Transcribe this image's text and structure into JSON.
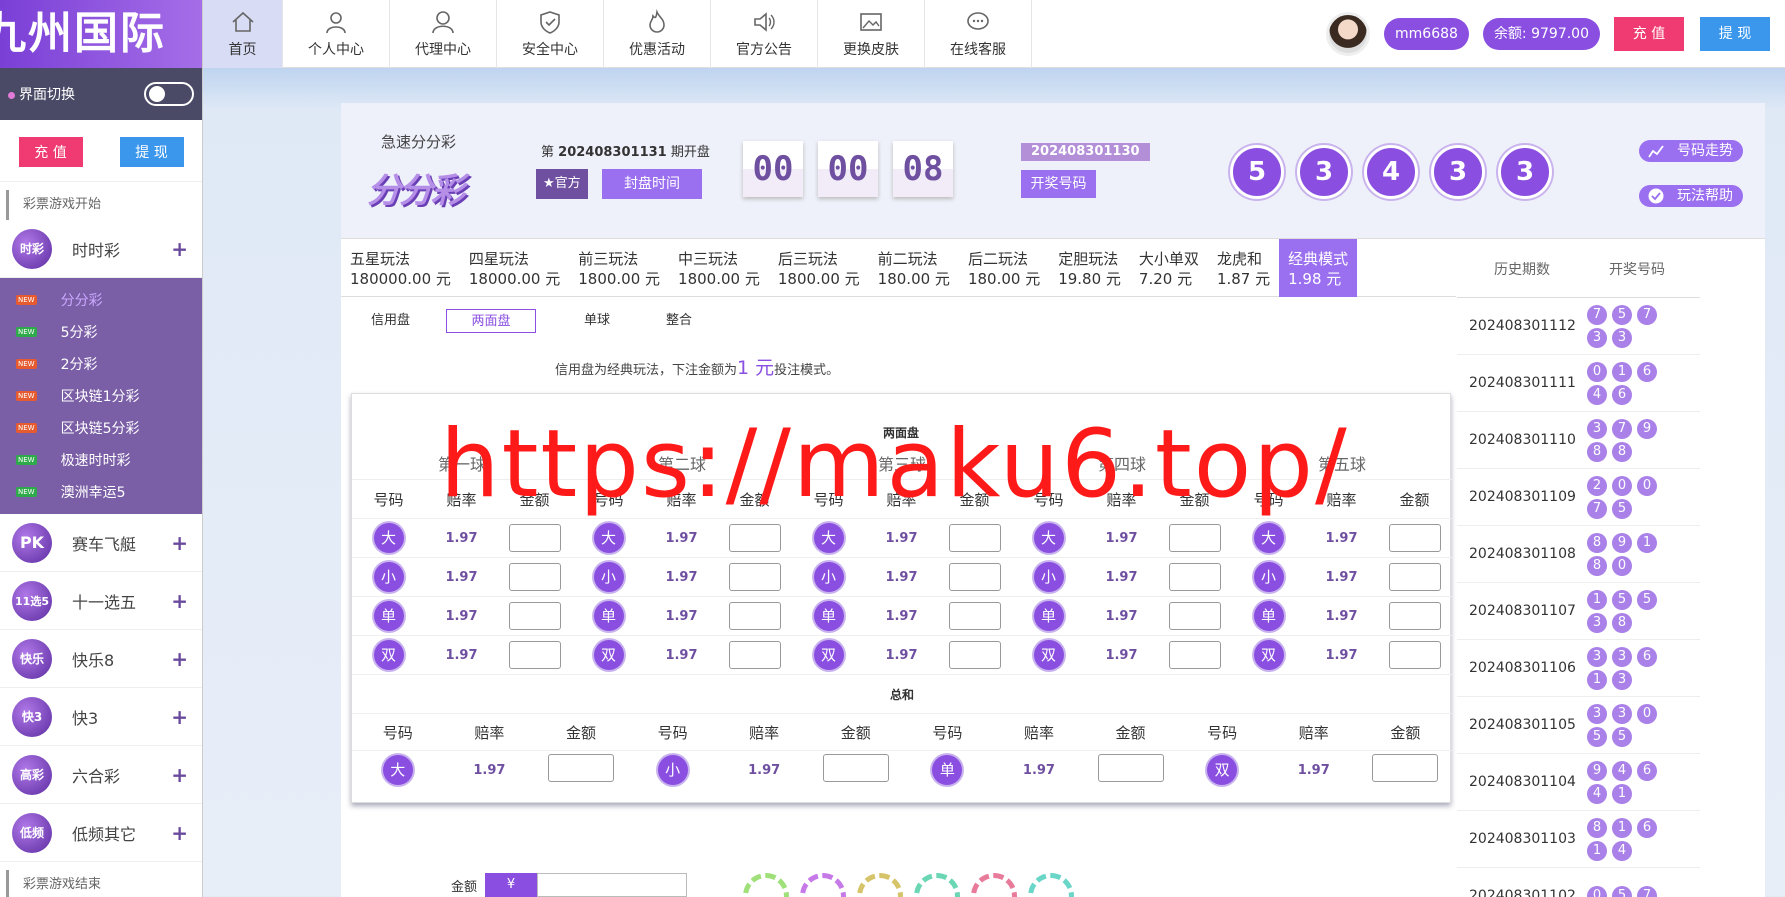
{
  "sidebar": {
    "logo": "九州国际",
    "ui_switch_label": "界面切换",
    "recharge": "充 值",
    "withdraw": "提 现",
    "start_caption": "彩票游戏开始",
    "end_caption": "彩票游戏结束",
    "categories_top": [
      {
        "label": "时时彩",
        "icon": "时彩"
      }
    ],
    "sub_items": [
      "分分彩",
      "5分彩",
      "2分彩",
      "区块链1分彩",
      "区块链5分彩",
      "极速时时彩",
      "澳洲幸运5"
    ],
    "new_badge": "NEW",
    "categories": [
      {
        "label": "赛车飞艇",
        "icon": "PK"
      },
      {
        "label": "十一选五",
        "icon": "11选5"
      },
      {
        "label": "快乐8",
        "icon": "快乐"
      },
      {
        "label": "快3",
        "icon": "快3"
      },
      {
        "label": "六合彩",
        "icon": "高彩"
      },
      {
        "label": "低频其它",
        "icon": "低频"
      }
    ]
  },
  "nav": {
    "items": [
      "首页",
      "个人中心",
      "代理中心",
      "安全中心",
      "优惠活动",
      "官方公告",
      "更换皮肤",
      "在线客服"
    ]
  },
  "user": {
    "username": "mm6688",
    "balance": "余额: 9797.00",
    "recharge": "充 值",
    "withdraw": "提 现"
  },
  "game": {
    "name": "急速分分彩",
    "logo_text": "分分彩",
    "issue_prefix": "第",
    "issue": "202408301131",
    "issue_suffix": "期开盘",
    "official": "★官方",
    "close_time": "封盘时间",
    "timer": [
      "00",
      "00",
      "08"
    ],
    "last_issue": "202408301130",
    "open_numbers_btn": "开奖号码",
    "last_numbers": [
      "5",
      "3",
      "4",
      "3",
      "3"
    ],
    "trend": "号码走势",
    "help": "玩法帮助"
  },
  "tabs": [
    {
      "name": "五星玩法",
      "price": "180000.00 元"
    },
    {
      "name": "四星玩法",
      "price": "18000.00 元"
    },
    {
      "name": "前三玩法",
      "price": "1800.00 元"
    },
    {
      "name": "中三玩法",
      "price": "1800.00 元"
    },
    {
      "name": "后三玩法",
      "price": "1800.00 元"
    },
    {
      "name": "前二玩法",
      "price": "180.00 元"
    },
    {
      "name": "后二玩法",
      "price": "180.00 元"
    },
    {
      "name": "定胆玩法",
      "price": "19.80 元"
    },
    {
      "name": "大小单双",
      "price": "7.20 元"
    },
    {
      "name": "龙虎和",
      "price": "1.87 元"
    },
    {
      "name": "经典模式",
      "price": "1.98 元"
    }
  ],
  "subtabs": [
    "信用盘",
    "两面盘",
    "单球",
    "整合"
  ],
  "note": {
    "before": "信用盘为经典玩法，下注金额为",
    "big": "1 元",
    "after": "投注模式。"
  },
  "bet": {
    "section_title": "两面盘",
    "balls": [
      "第一球",
      "第二球",
      "第三球",
      "第四球",
      "第五球"
    ],
    "col_num": "号码",
    "col_odds": "赔率",
    "col_amt": "金额",
    "options": [
      "大",
      "小",
      "单",
      "双"
    ],
    "odds": "1.97",
    "total_title": "总和"
  },
  "amount": {
    "label": "金额",
    "currency": "¥"
  },
  "history": {
    "col_issue": "历史期数",
    "col_numbers": "开奖号码",
    "rows": [
      {
        "issue": "202408301112",
        "nums": [
          "7",
          "5",
          "7",
          "3",
          "3"
        ]
      },
      {
        "issue": "202408301111",
        "nums": [
          "0",
          "1",
          "6",
          "4",
          "6"
        ]
      },
      {
        "issue": "202408301110",
        "nums": [
          "3",
          "7",
          "9",
          "8",
          "8"
        ]
      },
      {
        "issue": "202408301109",
        "nums": [
          "2",
          "0",
          "0",
          "7",
          "5"
        ]
      },
      {
        "issue": "202408301108",
        "nums": [
          "8",
          "9",
          "1",
          "8",
          "0"
        ]
      },
      {
        "issue": "202408301107",
        "nums": [
          "1",
          "5",
          "5",
          "3",
          "8"
        ]
      },
      {
        "issue": "202408301106",
        "nums": [
          "3",
          "3",
          "6",
          "1",
          "3"
        ]
      },
      {
        "issue": "202408301105",
        "nums": [
          "3",
          "3",
          "0",
          "5",
          "5"
        ]
      },
      {
        "issue": "202408301104",
        "nums": [
          "9",
          "4",
          "6",
          "4",
          "1"
        ]
      },
      {
        "issue": "202408301103",
        "nums": [
          "8",
          "1",
          "6",
          "1",
          "4"
        ]
      },
      {
        "issue": "202408301102",
        "nums": [
          "0",
          "5",
          "7"
        ]
      }
    ]
  },
  "watermark": "https://maku6.top/"
}
